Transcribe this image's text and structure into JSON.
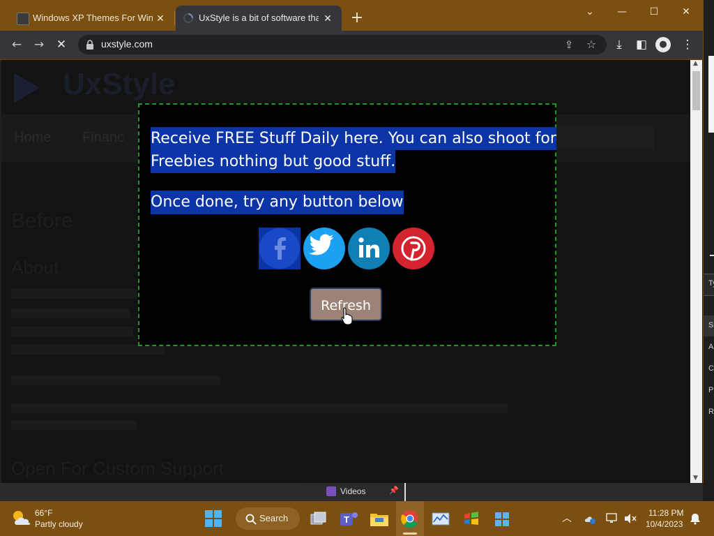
{
  "browser": {
    "tabs": [
      {
        "title": "Windows XP Themes For Windo",
        "active": false
      },
      {
        "title": "UxStyle is a bit of software that c",
        "active": true
      }
    ],
    "url": "uxstyle.com"
  },
  "page_background": {
    "logo": "UxStyle",
    "nav": [
      "Home",
      "Financ"
    ],
    "heading": "Before",
    "subheading": "About",
    "footer_heading": "Open For Custom Support"
  },
  "popup": {
    "line1": "Receive FREE Stuff Daily here. You can also shoot for",
    "line2": "Freebies nothing but good stuff.",
    "line3": "Once done, try any button below",
    "social": [
      "facebook-icon",
      "twitter-icon",
      "linkedin-icon",
      "pinterest-icon"
    ],
    "refresh_label": "Refresh"
  },
  "videos_bar": {
    "label": "Videos"
  },
  "taskbar": {
    "weather_temp": "66°F",
    "weather_desc": "Partly cloudy",
    "search_label": "Search",
    "time": "11:28 PM",
    "date": "10/4/2023"
  },
  "desktop_sidebar": {
    "type_label": "Ty",
    "items": [
      "Sl",
      "A",
      "C",
      "P",
      "R"
    ]
  },
  "colors": {
    "titlebar": "#7a4f10",
    "popup_border": "#1f9a1f",
    "highlight": "#0b34a6",
    "refresh_button": "#9c8378",
    "facebook": "#1a49c7",
    "twitter": "#1da1f2",
    "linkedin": "#0f7fb5",
    "pinterest": "#d3232f"
  }
}
